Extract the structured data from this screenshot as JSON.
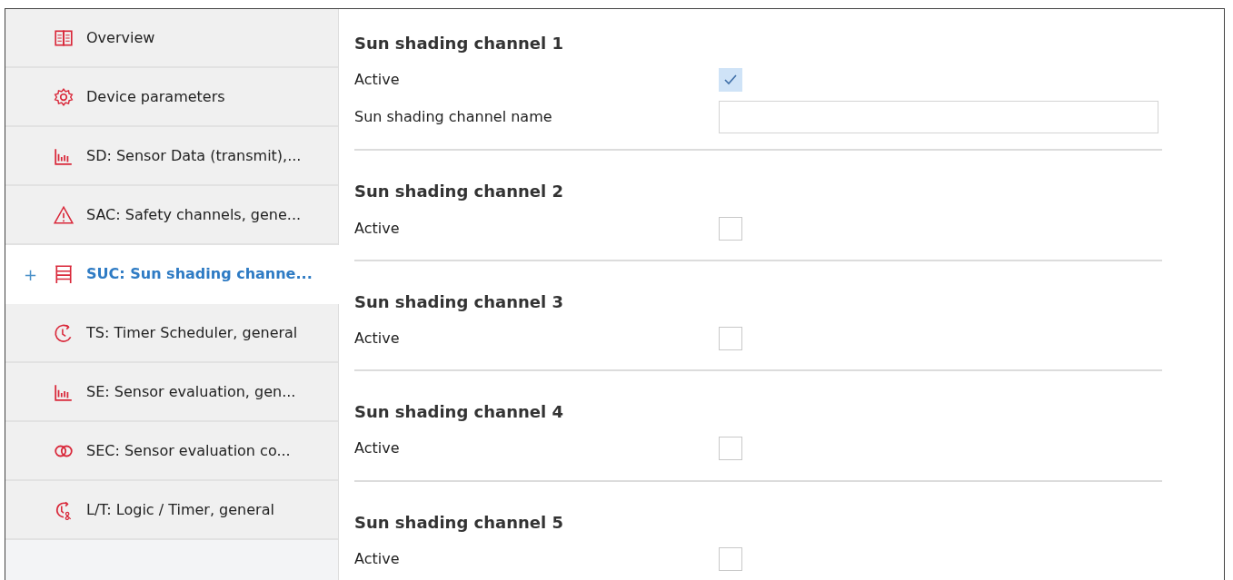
{
  "sidebar": {
    "items": [
      {
        "label": "Overview",
        "kind": "book",
        "selected": false
      },
      {
        "label": "Device parameters",
        "kind": "gear",
        "selected": false
      },
      {
        "label": "SD: Sensor Data (transmit),...",
        "kind": "chart",
        "selected": false
      },
      {
        "label": "SAC: Safety channels, gene...",
        "kind": "warning",
        "selected": false
      },
      {
        "label": "SUC: Sun shading channe...",
        "kind": "blinds",
        "selected": true,
        "expander": "+"
      },
      {
        "label": "TS: Timer Scheduler, general",
        "kind": "timer",
        "selected": false
      },
      {
        "label": "SE: Sensor evaluation, gen...",
        "kind": "chart",
        "selected": false
      },
      {
        "label": "SEC: Sensor evaluation co...",
        "kind": "rings",
        "selected": false
      },
      {
        "label": "L/T: Logic / Timer, general",
        "kind": "timer-logic",
        "selected": false
      }
    ]
  },
  "sections": [
    {
      "title": "Sun shading channel 1",
      "fields": [
        {
          "kind": "checkbox",
          "label": "Active",
          "checked": true
        },
        {
          "kind": "text",
          "label": "Sun shading channel name"
        }
      ]
    },
    {
      "title": "Sun shading channel 2",
      "fields": [
        {
          "kind": "checkbox",
          "label": "Active",
          "checked": false
        }
      ]
    },
    {
      "title": "Sun shading channel 3",
      "fields": [
        {
          "kind": "checkbox",
          "label": "Active",
          "checked": false
        }
      ]
    },
    {
      "title": "Sun shading channel 4",
      "fields": [
        {
          "kind": "checkbox",
          "label": "Active",
          "checked": false
        }
      ]
    },
    {
      "title": "Sun shading channel 5",
      "fields": [
        {
          "kind": "checkbox",
          "label": "Active",
          "checked": false
        }
      ]
    }
  ]
}
